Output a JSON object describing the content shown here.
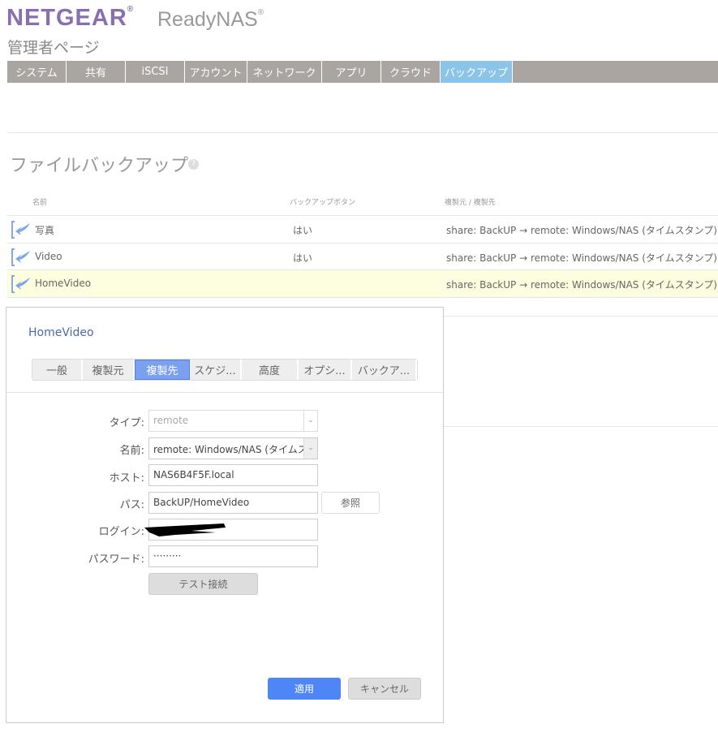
{
  "header": {
    "brand": "NETGEAR",
    "product": "ReadyNAS",
    "subtitle": "管理者ページ"
  },
  "nav": {
    "items": [
      "システム",
      "共有",
      "iSCSI",
      "アカウント",
      "ネットワーク",
      "アプリ",
      "クラウド",
      "バックアップ"
    ],
    "active": "バックアップ"
  },
  "page": {
    "title": "ファイルバックアップ",
    "help": "?"
  },
  "table": {
    "headers": [
      "名前",
      "バックアップボタン",
      "複製元 / 複製先"
    ],
    "rows": [
      {
        "name": "写真",
        "button": "はい",
        "route": "share: BackUP → remote: Windows/NAS (タイムスタンプ)"
      },
      {
        "name": "Video",
        "button": "はい",
        "route": "share: BackUP → remote: Windows/NAS (タイムスタンプ)"
      },
      {
        "name": "HomeVideo",
        "button": "",
        "route": "share: BackUP → remote: Windows/NAS (タイムスタンプ)"
      }
    ]
  },
  "dialog": {
    "title": "HomeVideo",
    "tabs": [
      "一般",
      "複製元",
      "複製先",
      "スケジ...",
      "高度",
      "オプシ...",
      "バックア..."
    ],
    "active_tab": "複製先",
    "fields": {
      "type_label": "タイプ:",
      "type_value": "remote",
      "name_label": "名前:",
      "name_value": "remote: Windows/NAS (タイムス",
      "host_label": "ホスト:",
      "host_value": "NAS6B4F5F.local",
      "path_label": "パス:",
      "path_value": "BackUP/HomeVideo",
      "browse": "参照",
      "login_label": "ログイン:",
      "login_value": "",
      "password_label": "パスワード:",
      "password_value": "·········"
    },
    "test_button": "テスト接続",
    "apply": "適用",
    "cancel": "キャンセル"
  },
  "colors": {
    "brand": "#8a6fb0",
    "nav": "#aaa5a0",
    "nav_active": "#8cc4e8",
    "selected_row": "#fdfde0",
    "apply": "#4f86f7"
  }
}
